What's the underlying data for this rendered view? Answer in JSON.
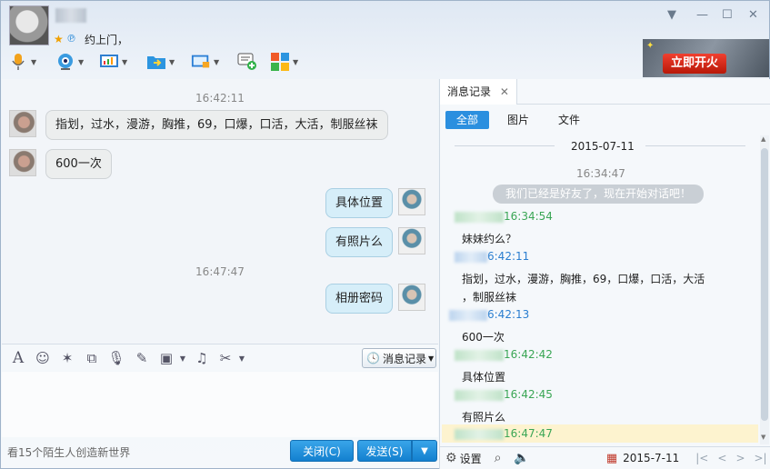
{
  "header": {
    "signature": "约上门，",
    "window_controls": [
      "chevron-down-icon",
      "minimize-icon",
      "maximize-icon",
      "close-icon"
    ],
    "ad_button": "立即开火"
  },
  "toolbar": {
    "items": [
      "voice-call-icon",
      "video-call-icon",
      "screen-share-icon",
      "send-file-icon",
      "remote-desktop-icon",
      "invite-icon",
      "apps-icon"
    ]
  },
  "chat": {
    "timestamps": [
      "16:42:11",
      "16:47:47"
    ],
    "messages": [
      {
        "side": "left",
        "text": "指划，过水，漫游，胸推，69，口爆，口活，大活，制服丝袜"
      },
      {
        "side": "left",
        "text": "600一次"
      },
      {
        "side": "right",
        "text": "具体位置"
      },
      {
        "side": "right",
        "text": "有照片么"
      },
      {
        "side": "right",
        "text": "相册密码"
      }
    ]
  },
  "input_toolbar": {
    "icons": [
      "font-icon",
      "emoji-icon",
      "shake-icon",
      "screenshot-icon",
      "voice-message-icon",
      "edit-icon",
      "image-icon",
      "music-icon",
      "scissors-icon"
    ],
    "history_label": "消息记录"
  },
  "footer": {
    "status_text": "看15个陌生人创造新世界",
    "close_label": "关闭(C)",
    "send_label": "发送(S)"
  },
  "history_panel": {
    "tab_title": "消息记录",
    "filters": [
      "全部",
      "图片",
      "文件"
    ],
    "date": "2015-07-11",
    "first_time": "16:34:47",
    "system_msg": "我们已经是好友了，现在开始对话吧！",
    "entries": [
      {
        "time": "16:34:54",
        "color": "#3aa655",
        "text": "妹妹约么？"
      },
      {
        "time": "6:42:11",
        "color": "#2a7ed0",
        "text": "指划，过水，漫游，胸推，69，口爆，口活，大活"
      },
      {
        "time": "6:42:13",
        "color": "#2a7ed0",
        "text": "600一次"
      },
      {
        "time": "16:42:42",
        "color": "#3aa655",
        "text": "具体位置"
      },
      {
        "time": "16:42:45",
        "color": "#3aa655",
        "text": "有照片么"
      },
      {
        "time": "16:47:47",
        "color": "#3aa655",
        "text": ""
      }
    ],
    "wrap_line": "，制服丝袜",
    "footer_settings": "设置",
    "footer_date": "2015-7-11"
  }
}
